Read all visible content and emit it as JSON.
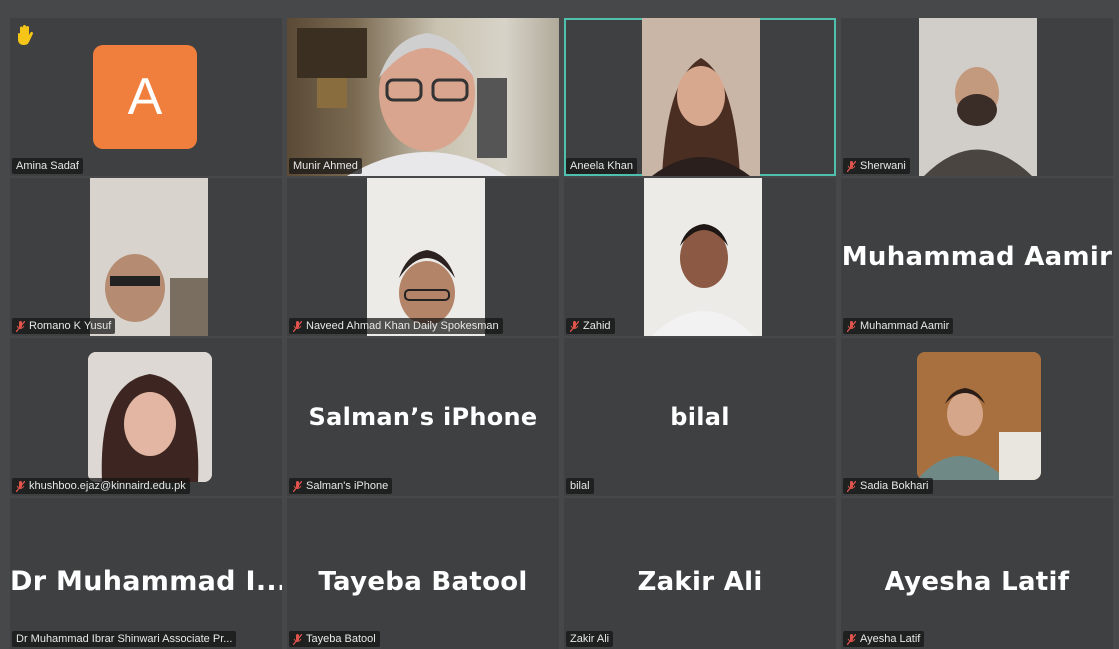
{
  "colors": {
    "accent_border": "#4fbfae",
    "avatar_bg": "#f07e3c",
    "hand": "#f5c518",
    "mic_muted": "#e0544c"
  },
  "participants": [
    {
      "tag": "Amina Sadaf",
      "muted": false,
      "avatar_letter": "A",
      "hand_raised": true,
      "hand_icon": "raised-hand-icon"
    },
    {
      "tag": "Munir Ahmed",
      "muted": false
    },
    {
      "tag": "Aneela Khan",
      "muted": false,
      "active_speaker": true
    },
    {
      "tag": "Sherwani",
      "muted": true
    },
    {
      "tag": "Romano K Yusuf",
      "muted": true
    },
    {
      "tag": "Naveed Ahmad Khan Daily Spokesman",
      "muted": true
    },
    {
      "tag": "Zahid",
      "muted": true
    },
    {
      "tag": "Muhammad Aamir",
      "muted": true,
      "display_name": "Muhammad Aamir"
    },
    {
      "tag": "khushboo.ejaz@kinnaird.edu.pk",
      "muted": true
    },
    {
      "tag": "Salman's iPhone",
      "muted": true,
      "display_name": "Salman’s iPhone"
    },
    {
      "tag": "bilal",
      "muted": false,
      "display_name": "bilal"
    },
    {
      "tag": "Sadia Bokhari",
      "muted": true
    },
    {
      "tag": "Dr Muhammad Ibrar Shinwari Associate Pr...",
      "muted": false,
      "display_name": "Dr Muhammad I..."
    },
    {
      "tag": "Tayeba Batool",
      "muted": true,
      "display_name": "Tayeba Batool"
    },
    {
      "tag": "Zakir Ali",
      "muted": false,
      "display_name": "Zakir Ali"
    },
    {
      "tag": "Ayesha Latif",
      "muted": true,
      "display_name": "Ayesha Latif"
    }
  ]
}
